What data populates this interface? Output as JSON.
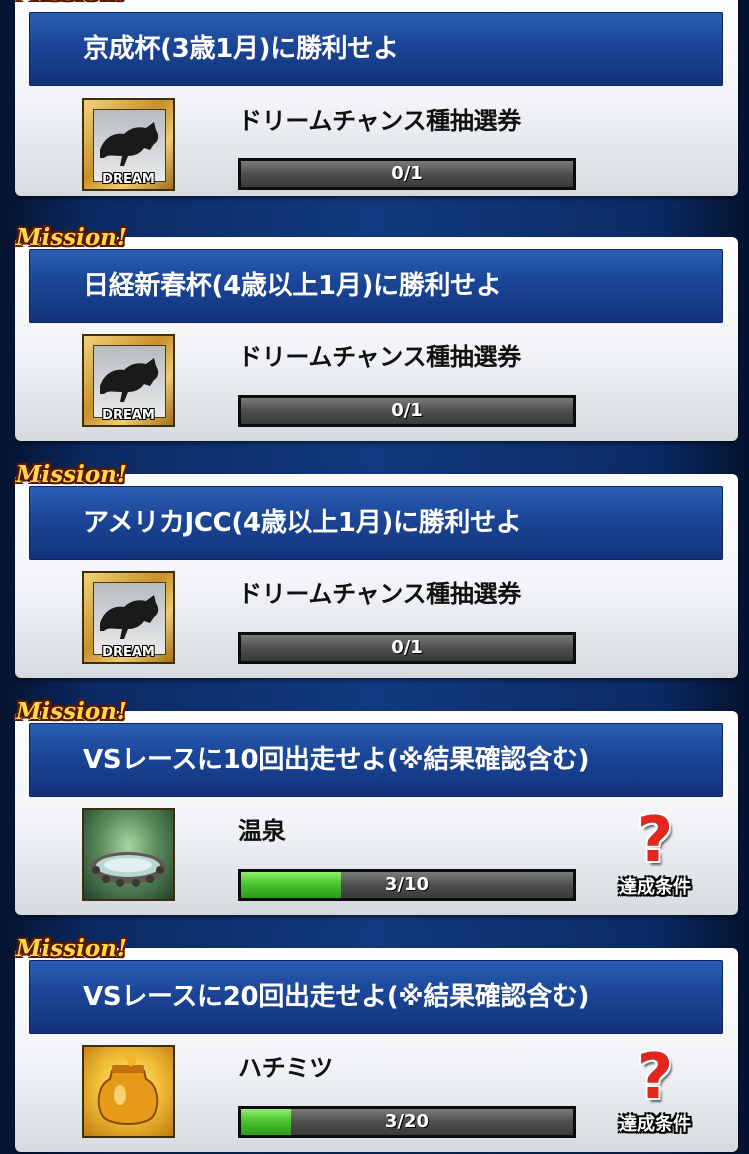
{
  "missions": [
    {
      "tag": "Mission!",
      "title": "京成杯(3歳1月)に勝利せよ",
      "reward": {
        "name": "ドリームチャンス種抽選券",
        "icon": "dream-ticket-icon",
        "label": "DREAM"
      },
      "progress": {
        "text": "0/1",
        "current": 0,
        "total": 1
      }
    },
    {
      "tag": "Mission!",
      "title": "日経新春杯(4歳以上1月)に勝利せよ",
      "reward": {
        "name": "ドリームチャンス種抽選券",
        "icon": "dream-ticket-icon",
        "label": "DREAM"
      },
      "progress": {
        "text": "0/1",
        "current": 0,
        "total": 1
      }
    },
    {
      "tag": "Mission!",
      "title": "アメリカJCC(4歳以上1月)に勝利せよ",
      "reward": {
        "name": "ドリームチャンス種抽選券",
        "icon": "dream-ticket-icon",
        "label": "DREAM"
      },
      "progress": {
        "text": "0/1",
        "current": 0,
        "total": 1
      }
    },
    {
      "tag": "Mission!",
      "title": "VSレースに10回出走せよ(※結果確認含む)",
      "reward": {
        "name": "温泉",
        "icon": "hot-spring-icon"
      },
      "progress": {
        "text": "3/10",
        "current": 3,
        "total": 10
      },
      "condition_button": "達成条件"
    },
    {
      "tag": "Mission!",
      "title": "VSレースに20回出走せよ(※結果確認含む)",
      "reward": {
        "name": "ハチミツ",
        "icon": "honey-jar-icon"
      },
      "progress": {
        "text": "3/20",
        "current": 3,
        "total": 20
      },
      "condition_button": "達成条件"
    }
  ],
  "colors": {
    "banner": "#1b4596",
    "progress_fill": "#45c02c",
    "mission_tag": "#ffd84a",
    "condition_question": "#e3261e"
  }
}
